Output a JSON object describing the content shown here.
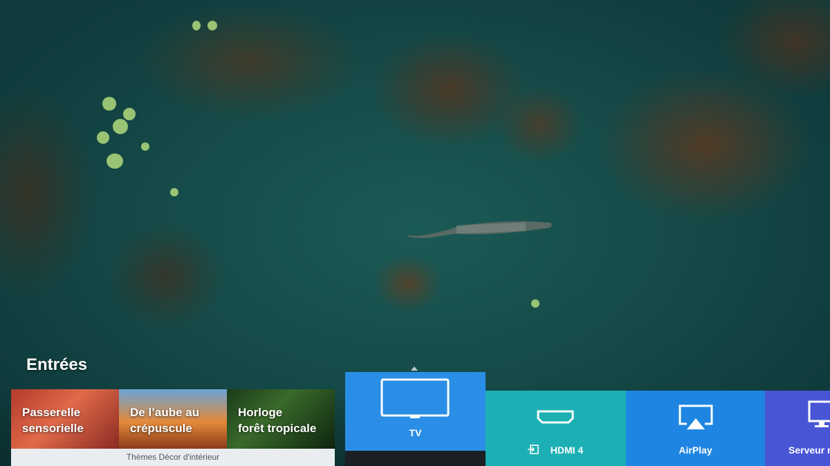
{
  "section_title": "Entrées",
  "themes": {
    "items": [
      {
        "label_line1": "Passerelle",
        "label_line2": "sensorielle"
      },
      {
        "label_line1": "De l’aube au",
        "label_line2": "crépuscule"
      },
      {
        "label_line1": "Horloge",
        "label_line2": "forêt tropicale"
      }
    ],
    "footer": "Thèmes Décor d'intérieur"
  },
  "sources": [
    {
      "label": "TV",
      "icon": "tv-icon",
      "selected": true
    },
    {
      "label": "HDMI 4",
      "icon": "hdmi-icon",
      "prefix_icon": "input-icon"
    },
    {
      "label": "AirPlay",
      "icon": "airplay-icon"
    },
    {
      "label": "Serveur m",
      "icon": "monitor-icon"
    }
  ],
  "colors": {
    "tv": "#2a8ee6",
    "hdmi": "#1cb0b4",
    "airplay": "#1e86e2",
    "server": "#4856d6"
  }
}
